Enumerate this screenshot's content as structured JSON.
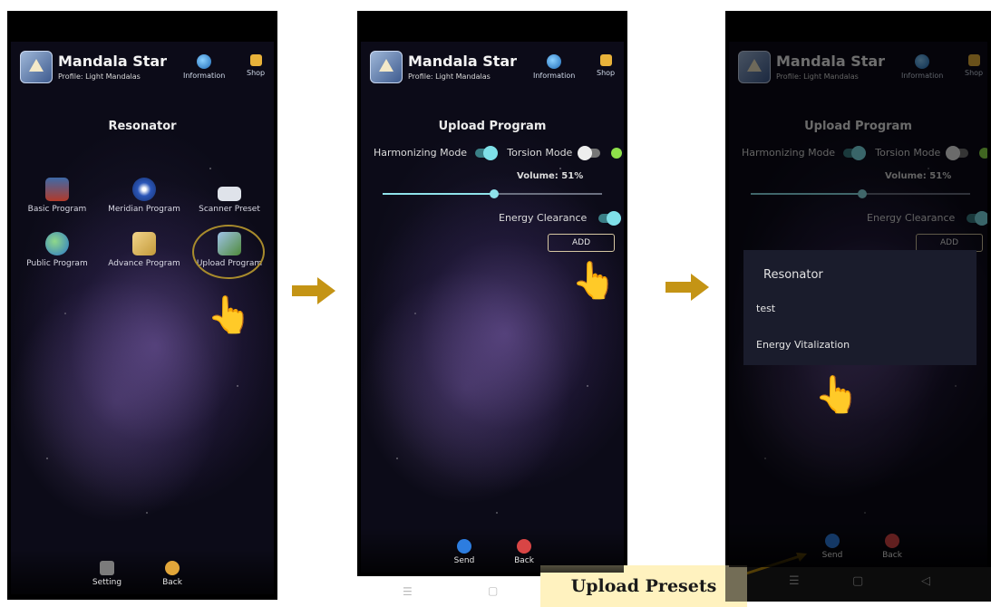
{
  "header": {
    "app_title": "Mandala Star",
    "profile": "Profile: Light Mandalas",
    "information_label": "Information",
    "shop_label": "Shop"
  },
  "screen1": {
    "title": "Resonator",
    "programs": [
      {
        "label": "Basic Program",
        "icon": "book-icon"
      },
      {
        "label": "Meridian Program",
        "icon": "compass-icon"
      },
      {
        "label": "Scanner Preset",
        "icon": "scanner-icon"
      },
      {
        "label": "Public Program",
        "icon": "globe-icon"
      },
      {
        "label": "Advance Program",
        "icon": "scroll-icon"
      },
      {
        "label": "Upload Program",
        "icon": "folder-upload-icon"
      }
    ],
    "setting_label": "Setting",
    "back_label": "Back"
  },
  "screen2": {
    "title": "Upload Program",
    "harmonizing_label": "Harmonizing Mode",
    "torsion_label": "Torsion Mode",
    "volume_label": "Volume: 51%",
    "volume_fraction": 0.51,
    "energy_label": "Energy Clearance",
    "add_label": "ADD",
    "send_label": "Send",
    "back_label": "Back"
  },
  "screen3": {
    "title": "Upload Program",
    "harmonizing_label": "Harmonizing Mode",
    "torsion_label": "Torsion Mode",
    "volume_label": "Volume: 51%",
    "energy_label": "Energy Clearance",
    "add_label": "ADD",
    "popup_title": "Resonator",
    "popup_items": [
      "test",
      "Energy Vitalization"
    ],
    "send_label": "Send",
    "back_label": "Back"
  },
  "callout": "Upload Presets",
  "colors": {
    "accent_arrow": "#c49415",
    "toggle_on": "#7fe0e8",
    "callout_bg": "#fff2bf",
    "status_green": "#8ee04a"
  }
}
